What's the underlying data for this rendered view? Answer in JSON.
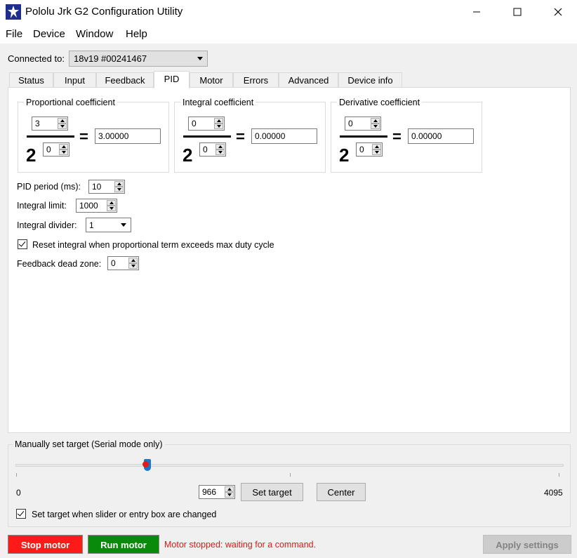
{
  "window": {
    "title": "Pololu Jrk G2 Configuration Utility",
    "minimize_icon": "minimize-icon",
    "maximize_icon": "maximize-icon",
    "close_icon": "close-icon"
  },
  "menu": [
    "File",
    "Device",
    "Window",
    "Help"
  ],
  "connection": {
    "label": "Connected to:",
    "device": "18v19 #00241467"
  },
  "tabs": [
    {
      "label": "Status",
      "active": false
    },
    {
      "label": "Input",
      "active": false
    },
    {
      "label": "Feedback",
      "active": false
    },
    {
      "label": "PID",
      "active": true
    },
    {
      "label": "Motor",
      "active": false
    },
    {
      "label": "Errors",
      "active": false
    },
    {
      "label": "Advanced",
      "active": false
    },
    {
      "label": "Device info",
      "active": false
    }
  ],
  "pid": {
    "proportional": {
      "title": "Proportional coefficient",
      "multiplier": "3",
      "base": "2",
      "exponent": "0",
      "result": "3.00000"
    },
    "integral": {
      "title": "Integral coefficient",
      "multiplier": "0",
      "base": "2",
      "exponent": "0",
      "result": "0.00000"
    },
    "derivative": {
      "title": "Derivative coefficient",
      "multiplier": "0",
      "base": "2",
      "exponent": "0",
      "result": "0.00000"
    },
    "equals": "=",
    "period_label": "PID period (ms):",
    "period_value": "10",
    "integral_limit_label": "Integral limit:",
    "integral_limit_value": "1000",
    "integral_divider_label": "Integral divider:",
    "integral_divider_value": "1",
    "reset_integral_label": "Reset integral when proportional term exceeds max duty cycle",
    "reset_integral_checked": true,
    "dead_zone_label": "Feedback dead zone:",
    "dead_zone_value": "0"
  },
  "manual_target": {
    "title": "Manually set target (Serial mode only)",
    "min_label": "0",
    "max_label": "4095",
    "slider_value": 966,
    "slider_min": 0,
    "slider_max": 4095,
    "target_value": "966",
    "set_target_label": "Set target",
    "center_label": "Center",
    "auto_set_label": "Set target when slider or entry box are changed",
    "auto_set_checked": true
  },
  "bottom": {
    "stop_label": "Stop motor",
    "run_label": "Run motor",
    "status_text": "Motor stopped: waiting for a command.",
    "apply_label": "Apply settings"
  },
  "colors": {
    "stop_bg": "#ff1a1a",
    "run_bg": "#0a8a0a",
    "status_text": "#e0161a",
    "slider_thumb": "#1a76c9",
    "app_icon": "#1d2f8a"
  }
}
